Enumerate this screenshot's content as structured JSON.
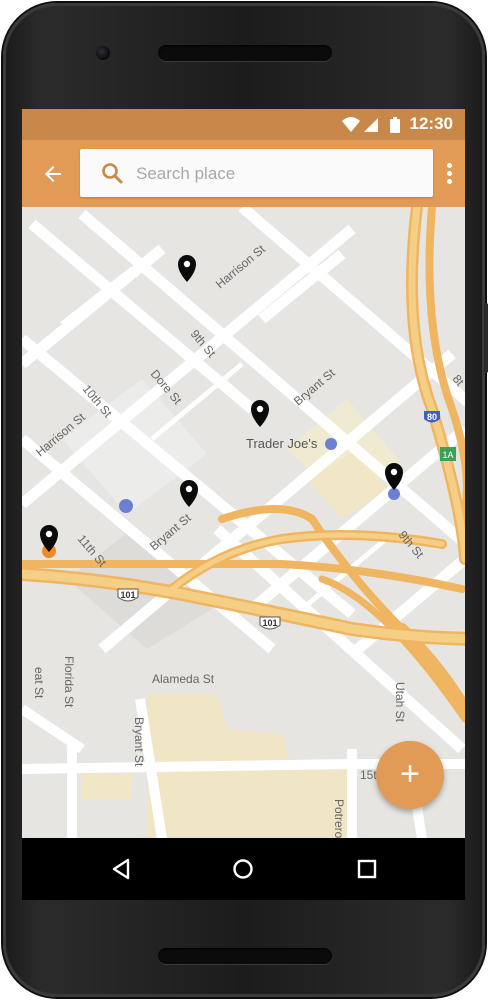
{
  "status_bar": {
    "time": "12:30"
  },
  "app_bar": {
    "search": {
      "placeholder": "Search place",
      "value": ""
    }
  },
  "map": {
    "street_labels": [
      "Harrison St",
      "9th St",
      "Dore St",
      "10th St",
      "Harrison St",
      "Bryant St",
      "Bryant St",
      "11th St",
      "9th St",
      "Alameda St",
      "Florida St",
      "Bryant St",
      "Utah St",
      "Potrero",
      "15t",
      "eat St",
      "8t"
    ],
    "highway_shields": [
      "101",
      "101",
      "80"
    ],
    "place_labels": [
      "Trader Joe's"
    ],
    "exit_label": "1A",
    "pins": [
      "location-pin",
      "location-pin",
      "location-pin",
      "location-pin",
      "location-pin"
    ]
  },
  "fab": {
    "label": "+"
  },
  "colors": {
    "accent": "#e29b56",
    "status": "#c8884a",
    "road_major": "#f6cf86"
  }
}
